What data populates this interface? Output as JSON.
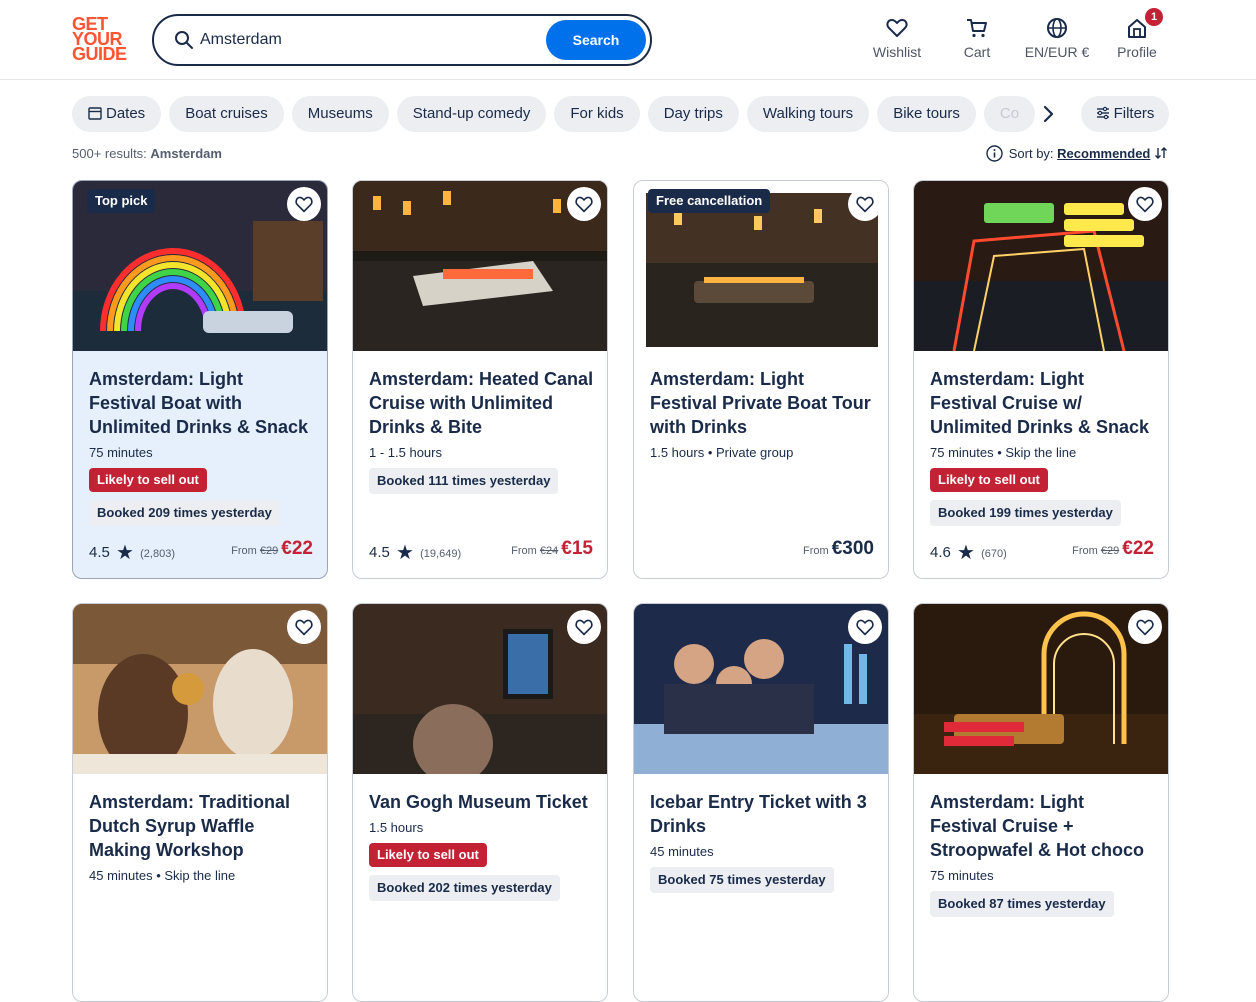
{
  "logo": {
    "line1": "GET",
    "line2": "YOUR",
    "line3": "GUIDE"
  },
  "search": {
    "value": "Amsterdam",
    "button": "Search"
  },
  "nav": {
    "wishlist": "Wishlist",
    "cart": "Cart",
    "language": "EN/EUR €",
    "profile": "Profile",
    "profile_badge": "1"
  },
  "chips": [
    "Dates",
    "Boat cruises",
    "Museums",
    "Stand-up comedy",
    "For kids",
    "Day trips",
    "Walking tours",
    "Bike tours",
    "Co"
  ],
  "filters_label": "Filters",
  "results": {
    "count": "500+ results:",
    "query": "Amsterdam"
  },
  "sort": {
    "label": "Sort by:",
    "value": "Recommended"
  },
  "colors": {
    "brand": "#ff5533",
    "accent": "#0071eb",
    "alert": "#c22234",
    "navy": "#1a2b49"
  },
  "cards": [
    {
      "tag": "Top pick",
      "title": "Amsterdam: Light Festival Boat with Unlimited Drinks & Snack",
      "meta": "75 minutes",
      "sell": "Likely to sell out",
      "booked": "Booked 209 times yesterday",
      "rating": "4.5",
      "reviews": "(2,803)",
      "from": "From",
      "old": "€29",
      "price": "€22"
    },
    {
      "tag": "",
      "title": "Amsterdam: Heated Canal Cruise with Unlimited Drinks & Bite",
      "meta": "1 - 1.5 hours",
      "sell": "",
      "booked": "Booked 111 times yesterday",
      "rating": "4.5",
      "reviews": "(19,649)",
      "from": "From",
      "old": "€24",
      "price": "€15"
    },
    {
      "tag": "Free cancellation",
      "title": "Amsterdam: Light Festival Private Boat Tour with Drinks",
      "meta": "1.5 hours • Private group",
      "sell": "",
      "booked": "",
      "rating": "",
      "reviews": "",
      "from": "From",
      "old": "",
      "price": "€300"
    },
    {
      "tag": "",
      "title": "Amsterdam: Light Festival Cruise w/ Unlimited Drinks & Snack",
      "meta": "75 minutes • Skip the line",
      "sell": "Likely to sell out",
      "booked": "Booked 199 times yesterday",
      "rating": "4.6",
      "reviews": "(670)",
      "from": "From",
      "old": "€29",
      "price": "€22"
    },
    {
      "tag": "",
      "title": "Amsterdam: Traditional Dutch Syrup Waffle Making Workshop",
      "meta": "45 minutes • Skip the line",
      "sell": "",
      "booked": "",
      "rating": "",
      "reviews": "",
      "from": "",
      "old": "",
      "price": ""
    },
    {
      "tag": "",
      "title": "Van Gogh Museum Ticket",
      "meta": "1.5 hours",
      "sell": "Likely to sell out",
      "booked": "Booked 202 times yesterday",
      "rating": "",
      "reviews": "",
      "from": "",
      "old": "",
      "price": ""
    },
    {
      "tag": "",
      "title": "Icebar Entry Ticket with 3 Drinks",
      "meta": "45 minutes",
      "sell": "",
      "booked": "Booked 75 times yesterday",
      "rating": "",
      "reviews": "",
      "from": "",
      "old": "",
      "price": ""
    },
    {
      "tag": "",
      "title": "Amsterdam: Light Festival Cruise + Stroopwafel & Hot choco",
      "meta": "75 minutes",
      "sell": "",
      "booked": "Booked 87 times yesterday",
      "rating": "",
      "reviews": "",
      "from": "",
      "old": "",
      "price": ""
    }
  ]
}
